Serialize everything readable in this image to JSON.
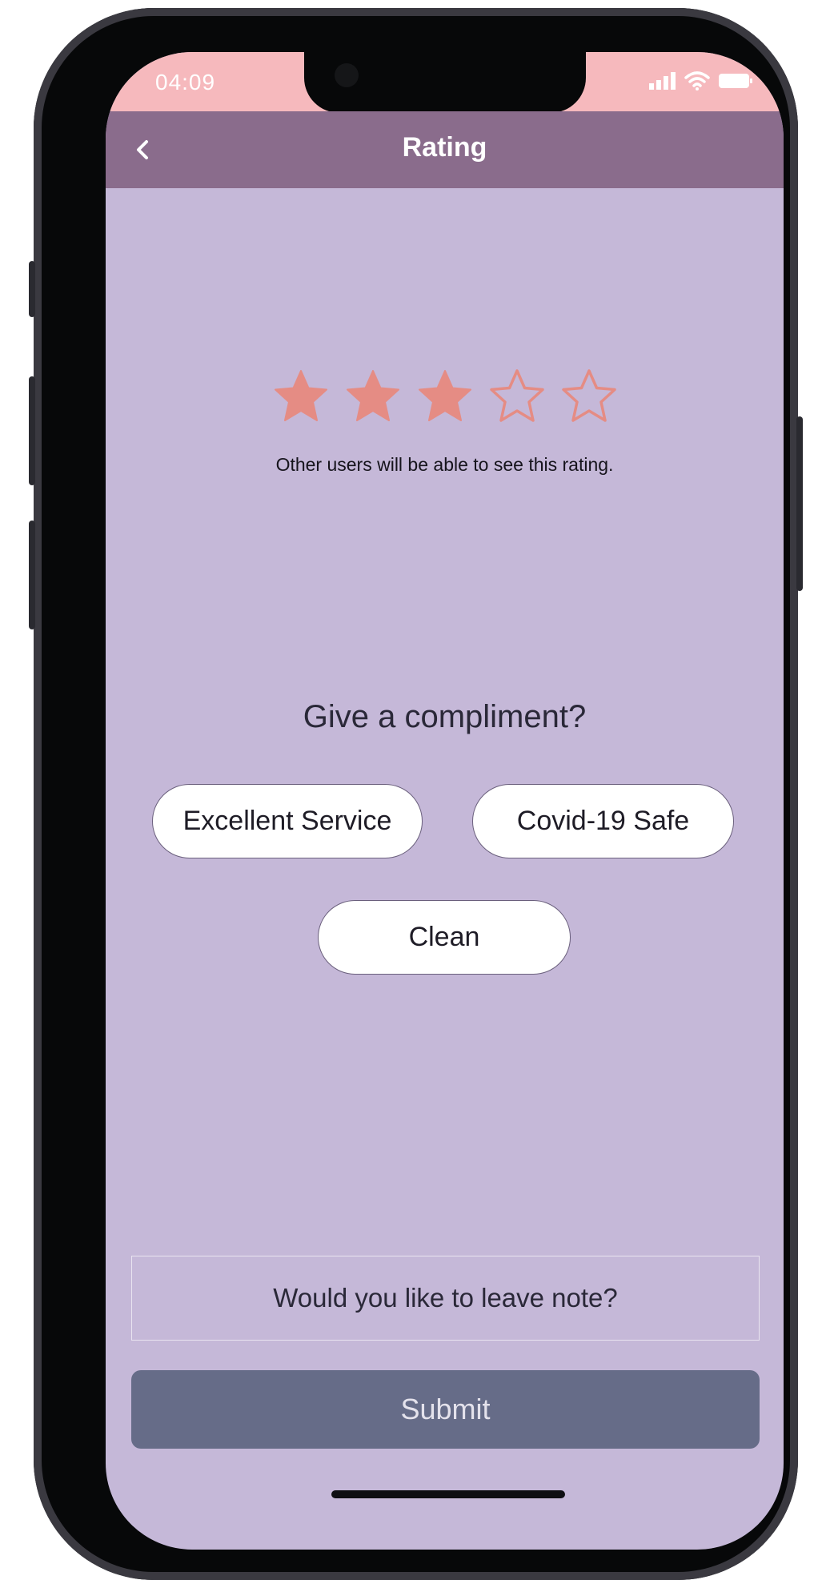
{
  "status_bar": {
    "time": "04:09"
  },
  "header": {
    "title": "Rating",
    "back_icon": "chevron-left-icon"
  },
  "rating": {
    "value": 3,
    "max": 5,
    "note": "Other users will be able to see this rating.",
    "color": "#e58c84"
  },
  "compliments": {
    "title": "Give a compliment?",
    "options": [
      "Excellent Service",
      "Covid-19 Safe",
      "Clean"
    ]
  },
  "note_field": {
    "label": "Would you like to leave note?"
  },
  "submit": {
    "label": "Submit"
  },
  "colors": {
    "status_bar": "#f6b9bd",
    "nav_bar": "#8a6c8c",
    "background": "#c5b8d8",
    "submit_button": "#666c88"
  }
}
